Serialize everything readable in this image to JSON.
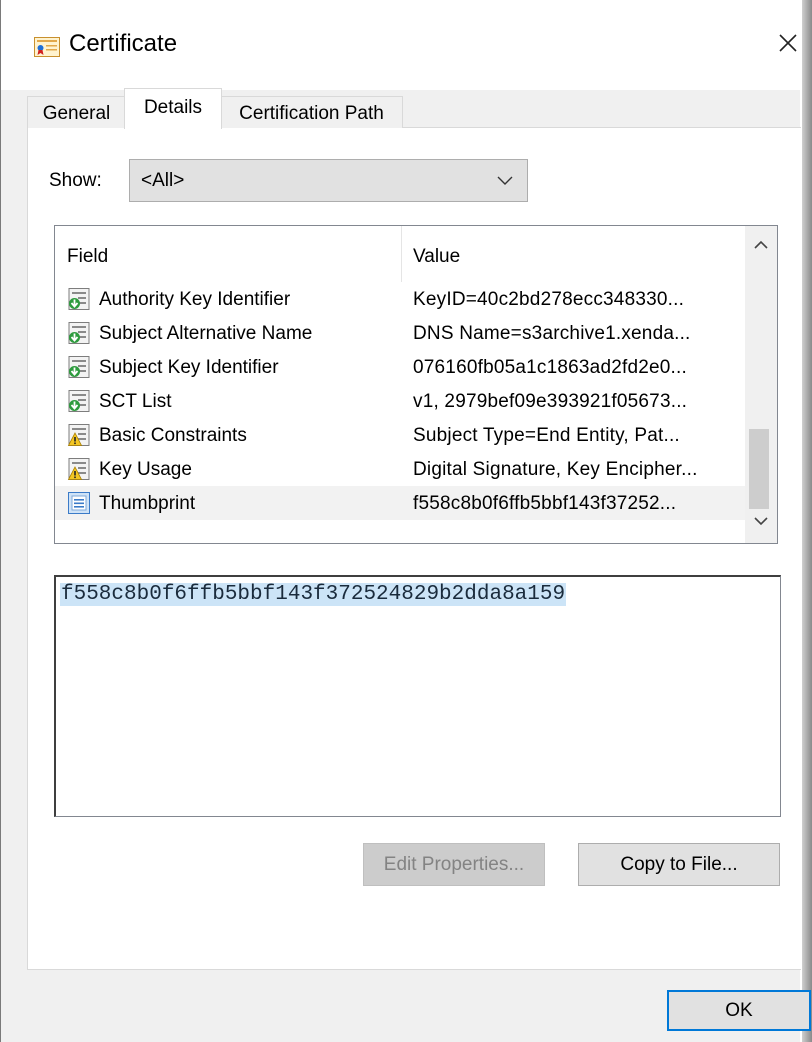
{
  "window": {
    "title": "Certificate"
  },
  "tabs": [
    {
      "label": "General"
    },
    {
      "label": "Details"
    },
    {
      "label": "Certification Path"
    }
  ],
  "show": {
    "label": "Show:",
    "selected": "<All>"
  },
  "list": {
    "columns": {
      "field": "Field",
      "value": "Value"
    },
    "rows": [
      {
        "field": "Authority Key Identifier",
        "value": "KeyID=40c2bd278ecc348330...",
        "icon": "extension-icon"
      },
      {
        "field": "Subject Alternative Name",
        "value": "DNS Name=s3archive1.xenda...",
        "icon": "extension-icon"
      },
      {
        "field": "Subject Key Identifier",
        "value": "076160fb05a1c1863ad2fd2e0...",
        "icon": "extension-icon"
      },
      {
        "field": "SCT List",
        "value": "v1, 2979bef09e393921f05673...",
        "icon": "extension-icon"
      },
      {
        "field": "Basic Constraints",
        "value": "Subject Type=End Entity, Pat...",
        "icon": "critical-extension-icon"
      },
      {
        "field": "Key Usage",
        "value": "Digital Signature, Key Encipher...",
        "icon": "critical-extension-icon"
      },
      {
        "field": "Thumbprint",
        "value": "f558c8b0f6ffb5bbf143f37252...",
        "icon": "property-icon"
      }
    ]
  },
  "detail": {
    "text": "f558c8b0f6ffb5bbf143f372524829b2dda8a159"
  },
  "buttons": {
    "edit": "Edit Properties...",
    "copy": "Copy to File...",
    "ok": "OK"
  }
}
